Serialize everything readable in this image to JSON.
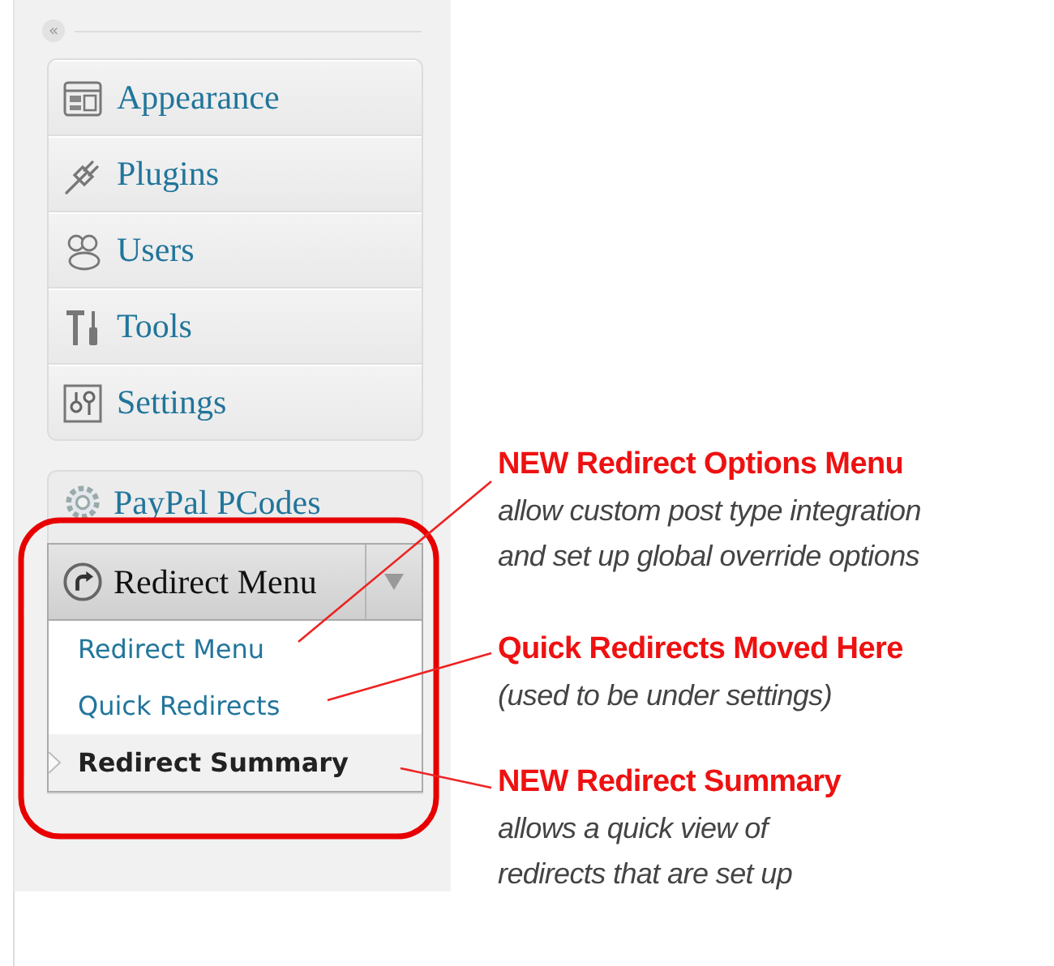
{
  "sidebar": {
    "collapse_icon": "«",
    "menu_items": [
      {
        "label": "Appearance"
      },
      {
        "label": "Plugins"
      },
      {
        "label": "Users"
      },
      {
        "label": "Tools"
      },
      {
        "label": "Settings"
      }
    ],
    "plugin_item": {
      "label": "PayPal PCodes"
    },
    "redirect_menu": {
      "label": "Redirect Menu",
      "expanded": true,
      "submenu": [
        {
          "label": "Redirect Menu",
          "selected": false
        },
        {
          "label": "Quick Redirects",
          "selected": false
        },
        {
          "label": "Redirect Summary",
          "selected": true
        }
      ]
    }
  },
  "annotations": [
    {
      "title": "NEW Redirect Options Menu",
      "lines": [
        "allow custom post type integration",
        "and set up global override options"
      ]
    },
    {
      "title": "Quick Redirects Moved Here",
      "lines": [
        "(used to be under settings)"
      ]
    },
    {
      "title": "NEW Redirect Summary",
      "lines": [
        "allows a quick view of",
        "redirects that are set up"
      ]
    }
  ]
}
